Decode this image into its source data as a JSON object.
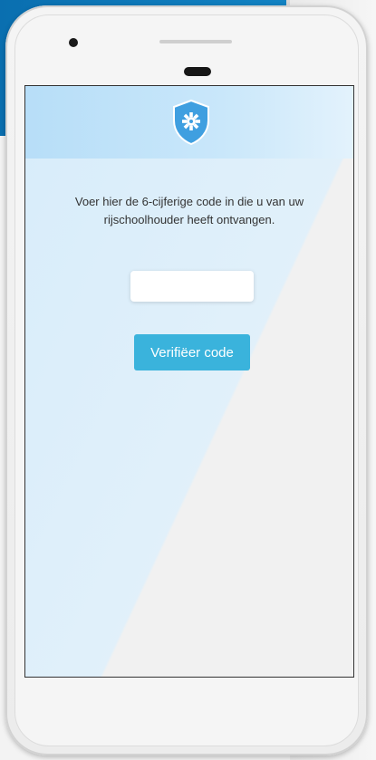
{
  "screen": {
    "instruction": "Voer hier de 6-cijferige code in die u van uw rijschoolhouder heeft ontvangen.",
    "code_input": {
      "value": "",
      "placeholder": ""
    },
    "verify_button_label": "Verifiëer code"
  },
  "icons": {
    "logo": "shield-gear-icon"
  },
  "colors": {
    "accent": "#3ab3dc",
    "shield": "#3f9fe0",
    "header_band": "#b7def8"
  }
}
